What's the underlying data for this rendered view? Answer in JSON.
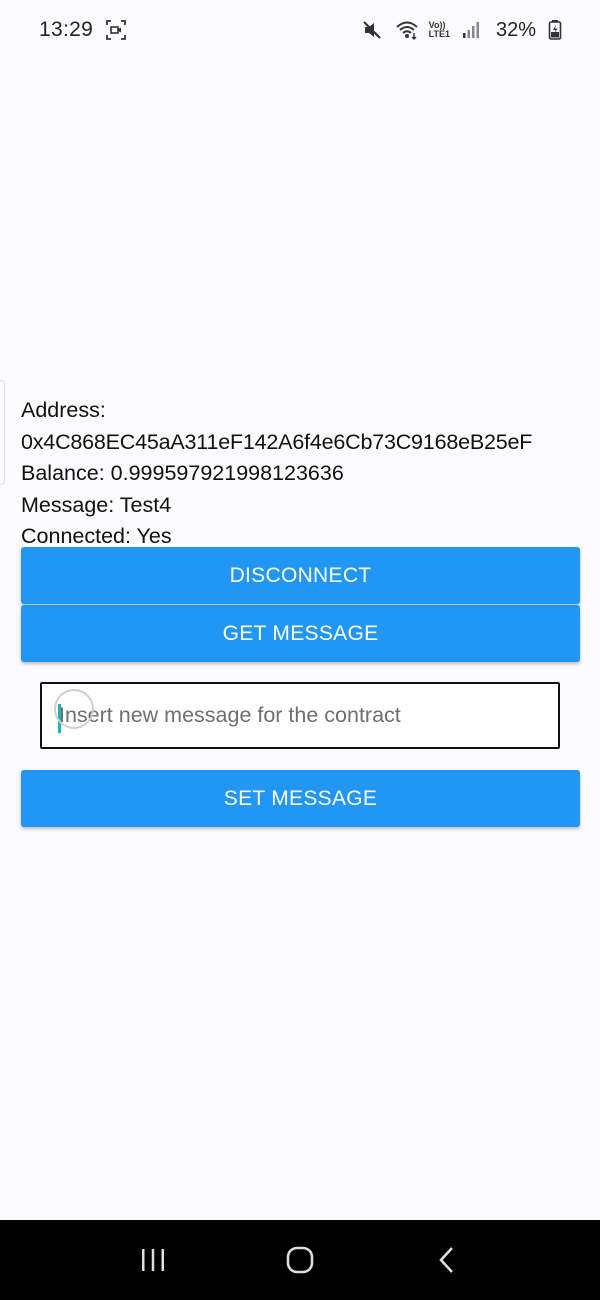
{
  "status_bar": {
    "time": "13:29",
    "battery": "32%",
    "icons": [
      "screen-record-icon",
      "mute-icon",
      "wifi-icon",
      "volte-icon",
      "signal-icon",
      "battery-icon"
    ],
    "volte_label_top": "Vo))",
    "volte_label_bottom": "LTE1"
  },
  "info": {
    "address_label": "Address:",
    "address_value": "0x4C868EC45aA311eF142A6f4e6Cb73C9168eB25eF",
    "balance": "Balance: 0.999597921998123636",
    "message": "Message: Test4",
    "connected": "Connected: Yes"
  },
  "buttons": {
    "disconnect": "DISCONNECT",
    "get_message": "GET MESSAGE",
    "set_message": "SET MESSAGE"
  },
  "input": {
    "placeholder": "Insert new message for the contract",
    "value": ""
  },
  "nav_bar": {
    "icons": [
      "recent-apps-icon",
      "home-icon",
      "back-icon"
    ]
  },
  "colors": {
    "accent": "#2196f3",
    "background": "#fbfbfe",
    "nav_background": "#000000",
    "cursor": "#19b7b0"
  }
}
